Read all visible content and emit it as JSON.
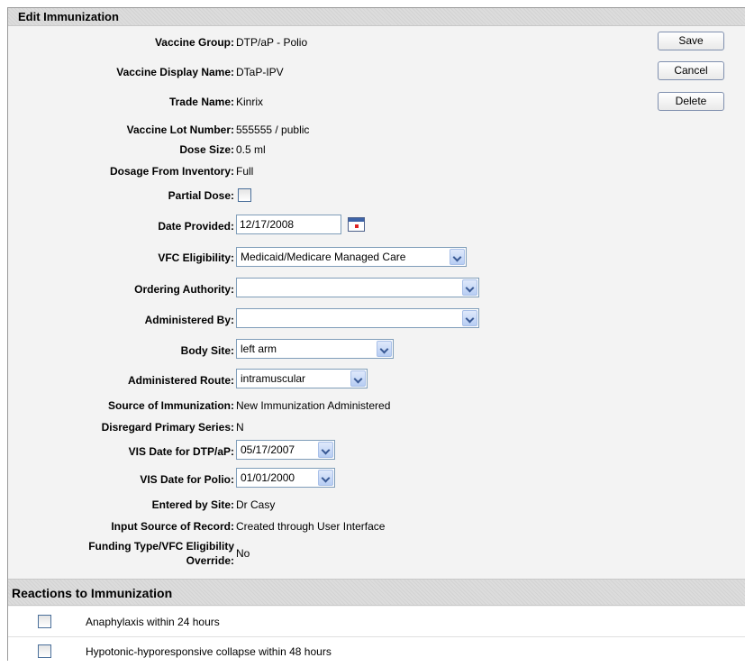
{
  "section_title": "Edit Immunization",
  "buttons": {
    "save": "Save",
    "cancel": "Cancel",
    "delete": "Delete"
  },
  "fields": {
    "vaccine_group": {
      "label": "Vaccine Group:",
      "value": "DTP/aP - Polio"
    },
    "vaccine_display_name": {
      "label": "Vaccine Display Name:",
      "value": "DTaP-IPV"
    },
    "trade_name": {
      "label": "Trade Name:",
      "value": "Kinrix"
    },
    "vaccine_lot_number": {
      "label": "Vaccine Lot Number:",
      "value": "555555 / public"
    },
    "dose_size": {
      "label": "Dose Size:",
      "value": "0.5 ml"
    },
    "dosage_from_inventory": {
      "label": "Dosage From Inventory:",
      "value": "Full"
    },
    "partial_dose": {
      "label": "Partial Dose:",
      "checked": false
    },
    "date_provided": {
      "label": "Date Provided:",
      "value": "12/17/2008"
    },
    "vfc_eligibility": {
      "label": "VFC Eligibility:",
      "value": "Medicaid/Medicare Managed Care"
    },
    "ordering_authority": {
      "label": "Ordering Authority:",
      "value": ""
    },
    "administered_by": {
      "label": "Administered By:",
      "value": ""
    },
    "body_site": {
      "label": "Body Site:",
      "value": "left arm"
    },
    "administered_route": {
      "label": "Administered Route:",
      "value": "intramuscular"
    },
    "source_of_immunization": {
      "label": "Source of Immunization:",
      "value": "New Immunization Administered"
    },
    "disregard_primary_series": {
      "label": "Disregard Primary Series:",
      "value": "N"
    },
    "vis_date_dtp": {
      "label": "VIS Date for DTP/aP:",
      "value": "05/17/2007"
    },
    "vis_date_polio": {
      "label": "VIS Date for Polio:",
      "value": "01/01/2000"
    },
    "entered_by_site": {
      "label": "Entered by Site:",
      "value": "Dr Casy"
    },
    "input_source": {
      "label": "Input Source of Record:",
      "value": "Created through User Interface"
    },
    "funding_override": {
      "label_line1": "Funding Type/VFC Eligibility",
      "label_line2": "Override:",
      "value": "No"
    }
  },
  "reactions": {
    "title": "Reactions to Immunization",
    "items": [
      {
        "label": "Anaphylaxis within 24 hours",
        "checked": false
      },
      {
        "label": "Hypotonic-hyporesponsive collapse within 48 hours",
        "checked": false
      }
    ]
  },
  "icons": {
    "calendar": "calendar-icon",
    "dropdown": "chevron-down-icon"
  }
}
